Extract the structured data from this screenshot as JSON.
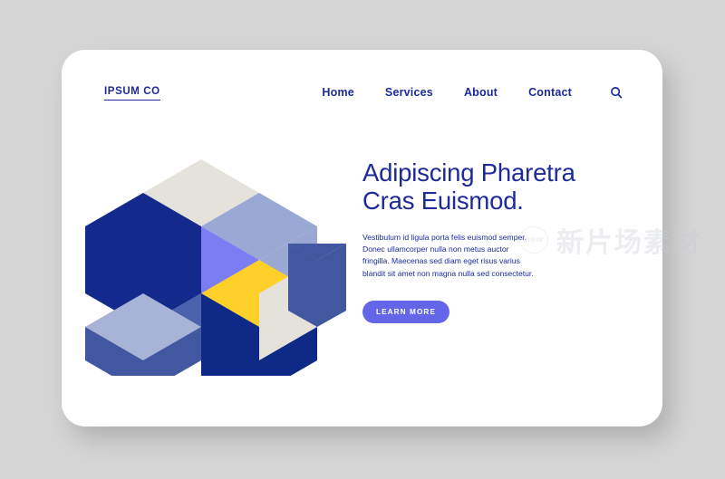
{
  "brand": {
    "logo_text": "IPSUM CO"
  },
  "nav": {
    "items": [
      {
        "label": "Home"
      },
      {
        "label": "Services"
      },
      {
        "label": "About"
      },
      {
        "label": "Contact"
      }
    ],
    "search_icon": "search-icon"
  },
  "hero": {
    "title": "Adipiscing Pharetra Cras Euismod.",
    "paragraph": "Vestibulum id ligula porta felis euismod semper. Donec ullamcorper nulla non metus auctor fringilla. Maecenas sed diam eget risus varius blandit sit amet non magna nulla sed consectetur.",
    "cta_label": "LEARN MORE"
  },
  "watermark": {
    "badge_text": "new",
    "text": "新片场素材"
  },
  "colors": {
    "page_background": "#d5d5d5",
    "card_background": "#ffffff",
    "brand_blue": "#1c2a9c",
    "cta_purple": "#6366e8",
    "navy_dark": "#132a8c",
    "navy_deep": "#0e2a86",
    "blue_medium": "#41579f",
    "blue_slate": "#4a62ab",
    "periwinkle_light": "#9aa8d4",
    "periwinkle_pale": "#a8b3d8",
    "violet_bright": "#7b7ef2",
    "beige": "#e4e2da",
    "yellow": "#ffd028"
  },
  "illustration": {
    "name": "isometric-cubes-graphic",
    "faces": [
      {
        "id": "top-left-beige-face",
        "color": "#e4e2da"
      },
      {
        "id": "top-right-periwinkle-face",
        "color": "#9aa8d4"
      },
      {
        "id": "left-navy-hexagon",
        "color": "#132a8c"
      },
      {
        "id": "center-violet-face",
        "color": "#7b7ef2"
      },
      {
        "id": "center-yellow-triangle",
        "color": "#ffd028"
      },
      {
        "id": "lower-left-slate-face",
        "color": "#4a62ab"
      },
      {
        "id": "lower-left-pale-face",
        "color": "#a8b3d8"
      },
      {
        "id": "lower-left-blue-face",
        "color": "#41579f"
      },
      {
        "id": "bottom-navy-face",
        "color": "#0e2a86"
      },
      {
        "id": "right-beige-face",
        "color": "#e4e2da"
      },
      {
        "id": "right-blue-top-face",
        "color": "#41579f"
      },
      {
        "id": "right-blue-side-face",
        "color": "#41579f"
      }
    ]
  }
}
